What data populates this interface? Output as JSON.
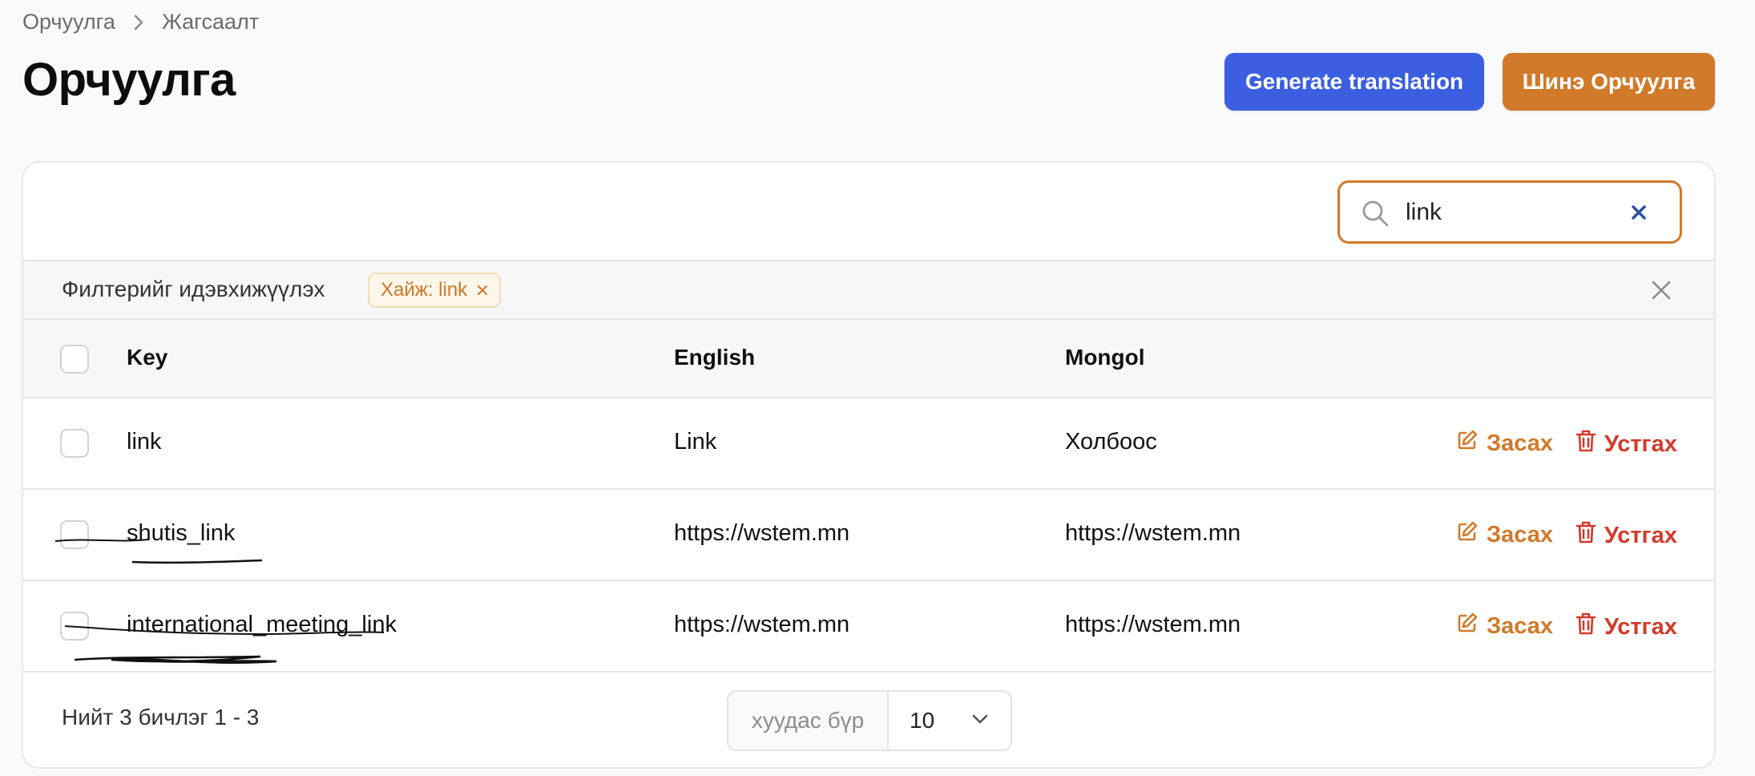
{
  "breadcrumb": {
    "items": [
      "Орчуулга",
      "Жагсаалт"
    ],
    "separator_icon": "chevron-right-icon"
  },
  "page": {
    "title": "Орчуулга"
  },
  "actions": {
    "generate_label": "Generate translation",
    "new_label": "Шинэ Орчуулга"
  },
  "search": {
    "value": "link",
    "icon": "search-icon",
    "clear_icon": "close-icon"
  },
  "filters": {
    "label": "Филтерийг идэвхижүүлэх",
    "chips": [
      {
        "label": "Хайж: link"
      }
    ]
  },
  "table": {
    "columns": [
      "Key",
      "English",
      "Mongol"
    ],
    "rows": [
      {
        "key": "link",
        "english": "Link",
        "mongol": "Холбоос"
      },
      {
        "key": "shutis_link",
        "english": "https://wstem.mn",
        "mongol": "https://wstem.mn"
      },
      {
        "key": "international_meeting_link",
        "english": "https://wstem.mn",
        "mongol": "https://wstem.mn"
      }
    ],
    "edit_label": "Засах",
    "delete_label": "Устгах"
  },
  "pagination": {
    "summary": "Нийт 3 бичлэг 1 - 3",
    "per_page_label": "хуудас бүр",
    "per_page_value": "10"
  },
  "colors": {
    "primary_blue": "#3b5fe0",
    "accent_orange": "#d07a2a",
    "danger_red": "#d23a2a",
    "page_background": "#fafafa"
  }
}
